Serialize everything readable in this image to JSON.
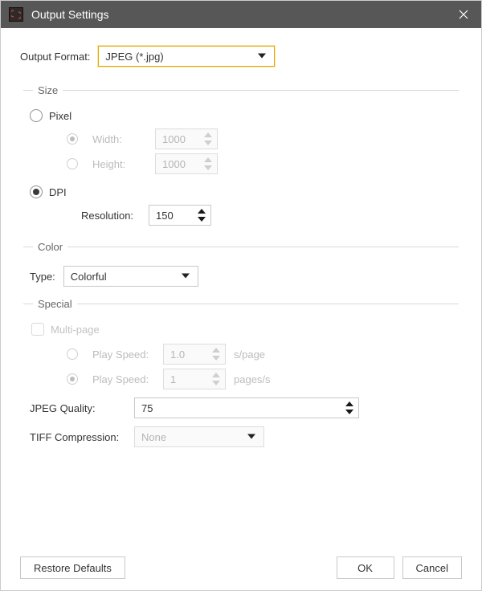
{
  "titlebar": {
    "title": "Output Settings"
  },
  "output_format": {
    "label": "Output Format:",
    "value": "JPEG (*.jpg)"
  },
  "size": {
    "legend": "Size",
    "pixel_label": "Pixel",
    "dpi_label": "DPI",
    "width_label": "Width:",
    "height_label": "Height:",
    "width_value": "1000",
    "height_value": "1000",
    "resolution_label": "Resolution:",
    "resolution_value": "150"
  },
  "color": {
    "legend": "Color",
    "type_label": "Type:",
    "type_value": "Colorful"
  },
  "special": {
    "legend": "Special",
    "multipage_label": "Multi-page",
    "play_speed_label_a": "Play Speed:",
    "play_speed_value_a": "1.0",
    "unit_a": "s/page",
    "play_speed_label_b": "Play Speed:",
    "play_speed_value_b": "1",
    "unit_b": "pages/s",
    "jpeg_quality_label": "JPEG Quality:",
    "jpeg_quality_value": "75",
    "tiff_label": "TIFF Compression:",
    "tiff_value": "None"
  },
  "footer": {
    "restore": "Restore Defaults",
    "ok": "OK",
    "cancel": "Cancel"
  }
}
